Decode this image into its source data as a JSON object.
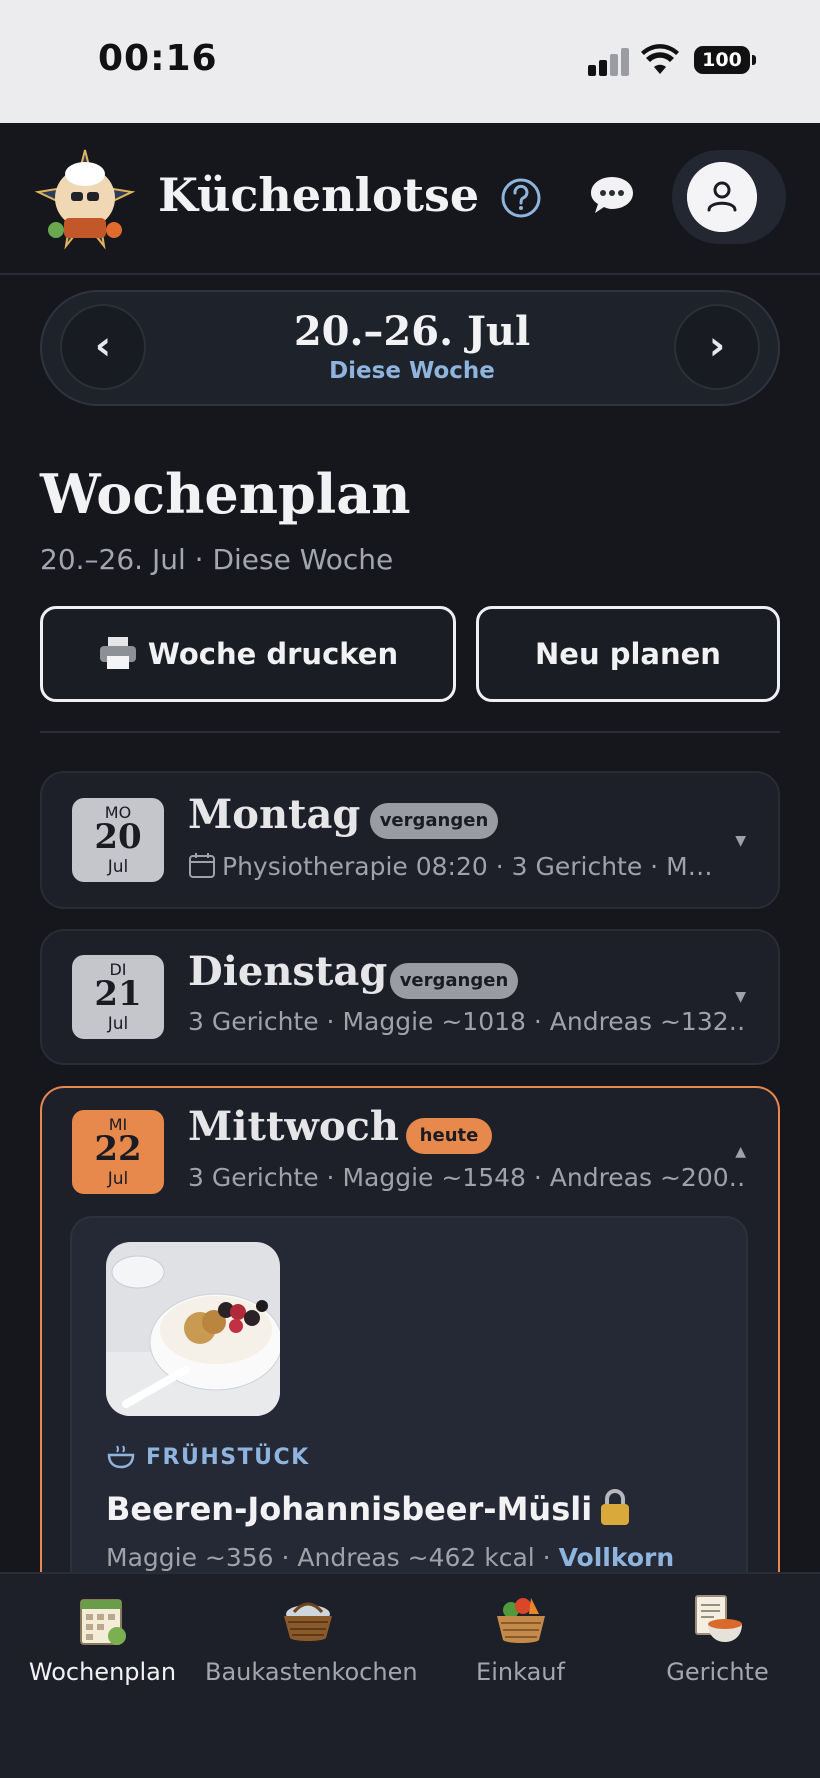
{
  "status_bar": {
    "time": "00:16",
    "battery": "100"
  },
  "header": {
    "app_title": "Küchenlotse"
  },
  "week_nav": {
    "range": "20.–26. Jul",
    "label": "Diese Woche",
    "prev": "‹",
    "next": "›"
  },
  "page": {
    "title": "Wochenplan",
    "subtitle": "20.–26. Jul · Diese Woche"
  },
  "actions": {
    "print_label": "Woche drucken",
    "replan_label": "Neu planen"
  },
  "days": [
    {
      "dow": "MO",
      "num": "20",
      "month": "Jul",
      "name": "Montag",
      "badge": "vergangen",
      "meta": "Physiotherapie 08:20 · 3 Gerichte · M…",
      "expanded": false
    },
    {
      "dow": "DI",
      "num": "21",
      "month": "Jul",
      "name": "Dienstag",
      "badge": "vergangen",
      "meta": "3 Gerichte · Maggie ~1018 · Andreas ~132…",
      "expanded": false
    },
    {
      "dow": "MI",
      "num": "22",
      "month": "Jul",
      "name": "Mittwoch",
      "badge": "heute",
      "meta": "3 Gerichte · Maggie ~1548 · Andreas ~200…",
      "expanded": true
    }
  ],
  "meal": {
    "category": "FRÜHSTÜCK",
    "title": "Beeren-Johannisbeer-Müsli",
    "kcal": "Maggie ~356 · Andreas ~462 kcal ·",
    "tag": "Vollkorn"
  },
  "bottom_nav": [
    {
      "label": "Wochenplan",
      "icon": "calendar-icon",
      "active": true
    },
    {
      "label": "Baukastenkochen",
      "icon": "basket-icon",
      "active": false
    },
    {
      "label": "Einkauf",
      "icon": "vegetable-basket-icon",
      "active": false
    },
    {
      "label": "Gerichte",
      "icon": "recipe-bowl-icon",
      "active": false
    }
  ],
  "colors": {
    "accent_today": "#e7884d",
    "link_blue": "#8fb4dd",
    "background": "#15171c",
    "card": "#1d2028"
  }
}
